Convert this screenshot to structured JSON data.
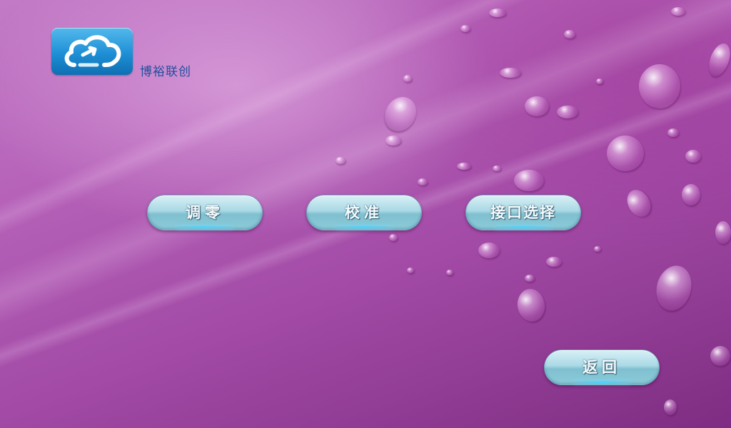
{
  "brand": {
    "icon": "cloud-icon",
    "name": "博裕联创"
  },
  "menu": {
    "zero_label": "调零",
    "calibrate_label": "校准",
    "interface_label": "接口选择"
  },
  "footer": {
    "back_label": "返回"
  },
  "colors": {
    "background": "#b561b8",
    "button": "#a9d9e5",
    "button_glow": "#4fd0ff",
    "logo": "#1e8fd5",
    "brand_text": "#1f4f9e"
  }
}
